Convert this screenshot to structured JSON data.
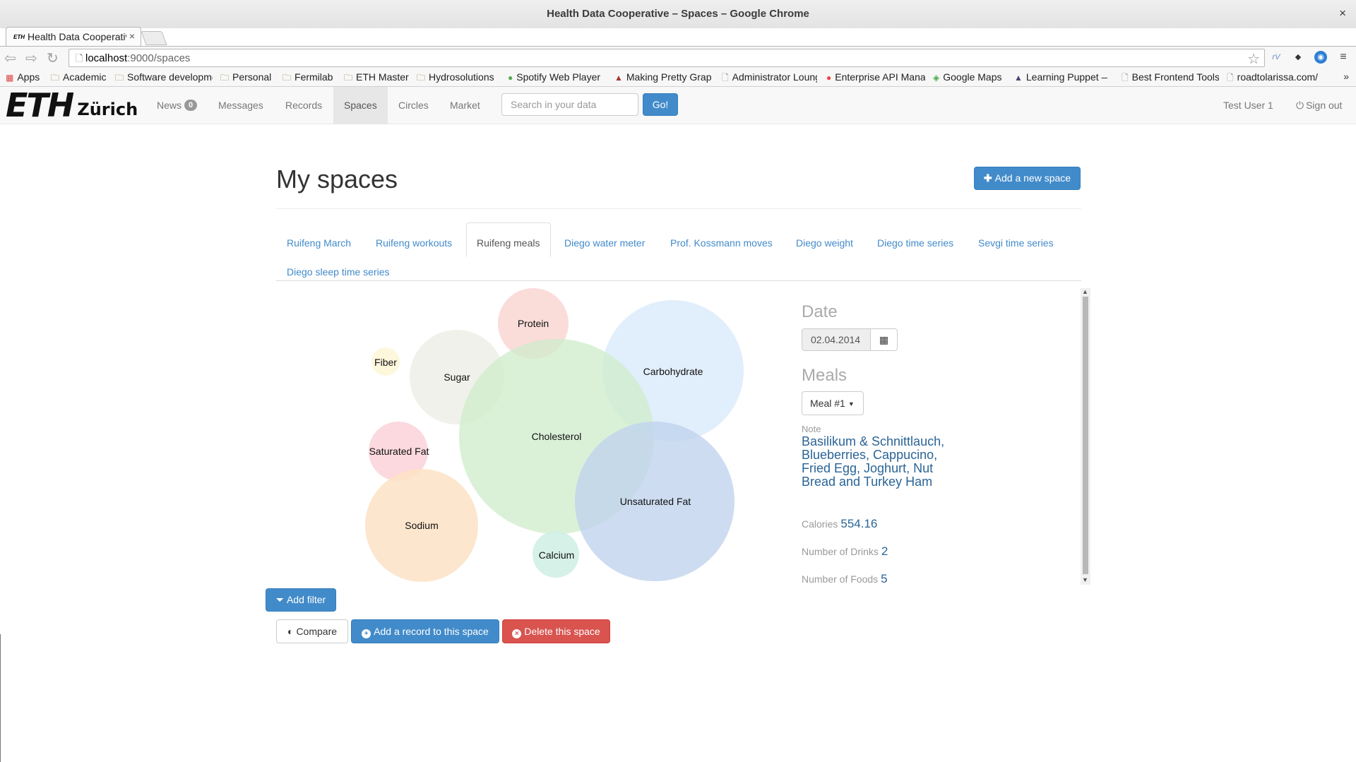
{
  "window": {
    "title": "Health Data Cooperative – Spaces – Google Chrome",
    "close_glyph": "×"
  },
  "browser": {
    "tab_title": "Health Data Cooperative – Spaces",
    "tab_favicon_text": "ETH",
    "url_host": "localhost",
    "url_path": ":9000/spaces",
    "bookmarks": [
      "Apps",
      "Academic",
      "Software development",
      "Personal",
      "Fermilab",
      "ETH Master",
      "Hydrosolutions",
      "Spotify Web Player",
      "Making Pretty Graphs",
      "Administrator Lounge",
      "Enterprise API Management",
      "Google Maps",
      "Learning Puppet — ",
      "Best Frontend Tools",
      "roadtolarissa.com/"
    ],
    "more_glyph": "»"
  },
  "nav": {
    "brand_main": "ETH",
    "brand_sub": "Zürich",
    "items": [
      "News",
      "Messages",
      "Records",
      "Spaces",
      "Circles",
      "Market"
    ],
    "news_badge": "0",
    "active_item": "Spaces",
    "search_placeholder": "Search in your data",
    "go_label": "Go!",
    "user": "Test User 1",
    "signout": "Sign out"
  },
  "page": {
    "title": "My spaces",
    "add_space_label": "Add a new space",
    "tabs": [
      "Ruifeng March",
      "Ruifeng workouts",
      "Ruifeng meals",
      "Diego water meter",
      "Prof. Kossmann moves",
      "Diego weight",
      "Diego time series",
      "Sevgi time series",
      "Diego sleep time series"
    ],
    "active_tab": "Ruifeng meals"
  },
  "bubbles": [
    {
      "label": "Protein",
      "color": "#f9d6d2"
    },
    {
      "label": "Fiber",
      "color": "#fdf6d8"
    },
    {
      "label": "Sugar",
      "color": "#eeeee8"
    },
    {
      "label": "Carbohydrate",
      "color": "#dcebfa"
    },
    {
      "label": "Cholesterol",
      "color": "#cdeccb"
    },
    {
      "label": "Saturated Fat",
      "color": "#fbd5da"
    },
    {
      "label": "Unsaturated Fat",
      "color": "#c9d9ef"
    },
    {
      "label": "Sodium",
      "color": "#fde2c6"
    },
    {
      "label": "Calcium",
      "color": "#d2efe4"
    }
  ],
  "details": {
    "date_heading": "Date",
    "date_value": "02.04.2014",
    "meals_heading": "Meals",
    "meal_selected": "Meal #1",
    "note_label": "Note",
    "note_text": "Basilikum & Schnittlauch, Blueberries, Cappucino, Fried Egg, Joghurt, Nut Bread and Turkey Ham",
    "calories_label": "Calories",
    "calories_value": "554.16",
    "drinks_label": "Number of Drinks",
    "drinks_value": "2",
    "foods_label": "Number of Foods",
    "foods_value": "5"
  },
  "actions": {
    "add_filter": "Add filter",
    "compare": "Compare",
    "add_record": "Add a record to this space",
    "delete_space": "Delete this space"
  }
}
